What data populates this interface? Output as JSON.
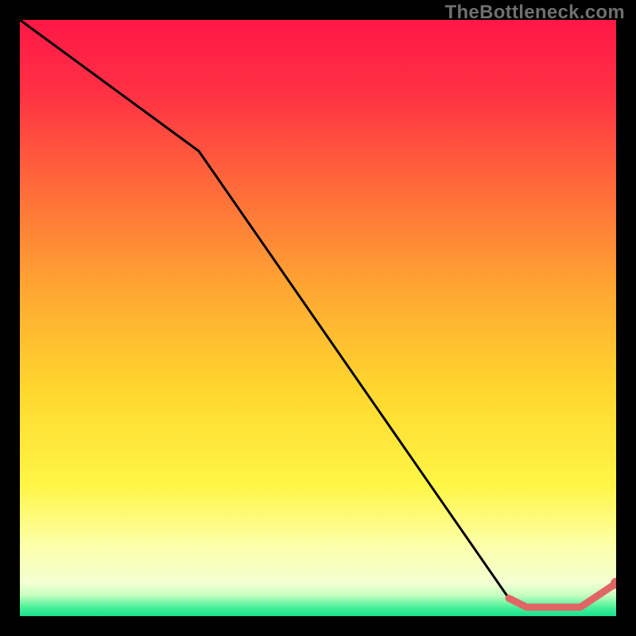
{
  "watermark": "TheBottleneck.com",
  "chart_data": {
    "type": "line",
    "title": "",
    "xlabel": "",
    "ylabel": "",
    "xlim": [
      0,
      100
    ],
    "ylim": [
      0,
      100
    ],
    "grid": false,
    "series": [
      {
        "name": "curve",
        "x": [
          0,
          30,
          82,
          85,
          94,
          100
        ],
        "y": [
          100,
          78,
          3,
          1.5,
          1.5,
          5.5
        ]
      }
    ],
    "highlight_segment": {
      "from_index": 2,
      "to_index": 5,
      "color": "#e06666",
      "dot_at_index": 5
    },
    "background_gradient": {
      "stops": [
        {
          "offset": 0.0,
          "color": "#ff1846"
        },
        {
          "offset": 0.12,
          "color": "#ff3044"
        },
        {
          "offset": 0.28,
          "color": "#ff6a3a"
        },
        {
          "offset": 0.45,
          "color": "#ffa632"
        },
        {
          "offset": 0.62,
          "color": "#ffd72e"
        },
        {
          "offset": 0.78,
          "color": "#fff645"
        },
        {
          "offset": 0.88,
          "color": "#fdffa8"
        },
        {
          "offset": 0.945,
          "color": "#f2ffd2"
        },
        {
          "offset": 0.965,
          "color": "#c6ffc0"
        },
        {
          "offset": 0.985,
          "color": "#4cf09a"
        },
        {
          "offset": 1.0,
          "color": "#18e08c"
        }
      ]
    }
  }
}
